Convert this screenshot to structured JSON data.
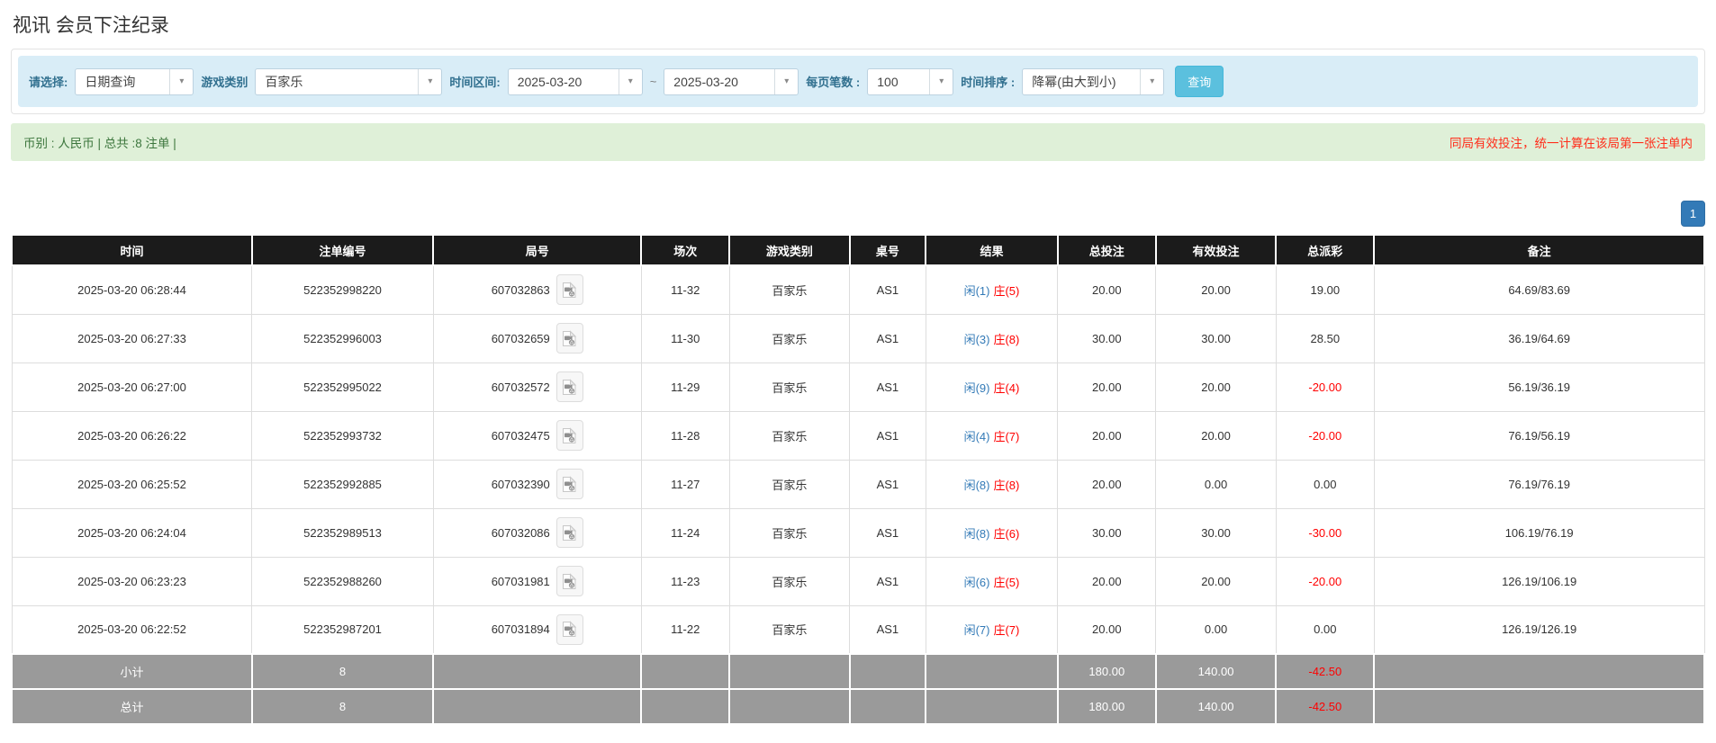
{
  "page": {
    "title": "视讯 会员下注纪录"
  },
  "filters": {
    "select_label": "请选择:",
    "select_value": "日期查询",
    "game_type_label": "游戏类别",
    "game_type_value": "百家乐",
    "date_range_label": "时间区间:",
    "date_from": "2025-03-20",
    "date_separator": "~",
    "date_to": "2025-03-20",
    "page_size_label": "每页笔数 :",
    "page_size_value": "100",
    "sort_label": "时间排序 :",
    "sort_value": "降幂(由大到小)",
    "query_button": "查询"
  },
  "summary": {
    "left": "币别 : 人民币 | 总共 :8 注单 |",
    "right": "同局有效投注，统一计算在该局第一张注单内"
  },
  "pagination": {
    "current": "1"
  },
  "icons": {
    "video_icon": "video-replay-file",
    "chevron": "▾"
  },
  "colors": {
    "accent_blue": "#5bc0de",
    "link_blue": "#337ab7",
    "negative_red": "#ff0000",
    "header_bg": "#1b1b1b",
    "footer_bg": "#9a9a9a",
    "filter_bg": "#d9edf7",
    "summary_bg": "#dff0d8",
    "summary_green": "#3c763d"
  },
  "table": {
    "headers": [
      "时间",
      "注单编号",
      "局号",
      "场次",
      "游戏类别",
      "桌号",
      "结果",
      "总投注",
      "有效投注",
      "总派彩",
      "备注"
    ],
    "rows": [
      {
        "time": "2025-03-20 06:28:44",
        "bet_id": "522352998220",
        "round_id": "607032863",
        "session": "11-32",
        "game": "百家乐",
        "table_no": "AS1",
        "result_player": "闲(1)",
        "result_banker": "庄(5)",
        "total_bet": "20.00",
        "valid_bet": "20.00",
        "payout": "19.00",
        "remark": "64.69/83.69"
      },
      {
        "time": "2025-03-20 06:27:33",
        "bet_id": "522352996003",
        "round_id": "607032659",
        "session": "11-30",
        "game": "百家乐",
        "table_no": "AS1",
        "result_player": "闲(3)",
        "result_banker": "庄(8)",
        "total_bet": "30.00",
        "valid_bet": "30.00",
        "payout": "28.50",
        "remark": "36.19/64.69"
      },
      {
        "time": "2025-03-20 06:27:00",
        "bet_id": "522352995022",
        "round_id": "607032572",
        "session": "11-29",
        "game": "百家乐",
        "table_no": "AS1",
        "result_player": "闲(9)",
        "result_banker": "庄(4)",
        "total_bet": "20.00",
        "valid_bet": "20.00",
        "payout": "-20.00",
        "remark": "56.19/36.19"
      },
      {
        "time": "2025-03-20 06:26:22",
        "bet_id": "522352993732",
        "round_id": "607032475",
        "session": "11-28",
        "game": "百家乐",
        "table_no": "AS1",
        "result_player": "闲(4)",
        "result_banker": "庄(7)",
        "total_bet": "20.00",
        "valid_bet": "20.00",
        "payout": "-20.00",
        "remark": "76.19/56.19"
      },
      {
        "time": "2025-03-20 06:25:52",
        "bet_id": "522352992885",
        "round_id": "607032390",
        "session": "11-27",
        "game": "百家乐",
        "table_no": "AS1",
        "result_player": "闲(8)",
        "result_banker": "庄(8)",
        "total_bet": "20.00",
        "valid_bet": "0.00",
        "payout": "0.00",
        "remark": "76.19/76.19"
      },
      {
        "time": "2025-03-20 06:24:04",
        "bet_id": "522352989513",
        "round_id": "607032086",
        "session": "11-24",
        "game": "百家乐",
        "table_no": "AS1",
        "result_player": "闲(8)",
        "result_banker": "庄(6)",
        "total_bet": "30.00",
        "valid_bet": "30.00",
        "payout": "-30.00",
        "remark": "106.19/76.19"
      },
      {
        "time": "2025-03-20 06:23:23",
        "bet_id": "522352988260",
        "round_id": "607031981",
        "session": "11-23",
        "game": "百家乐",
        "table_no": "AS1",
        "result_player": "闲(6)",
        "result_banker": "庄(5)",
        "total_bet": "20.00",
        "valid_bet": "20.00",
        "payout": "-20.00",
        "remark": "126.19/106.19"
      },
      {
        "time": "2025-03-20 06:22:52",
        "bet_id": "522352987201",
        "round_id": "607031894",
        "session": "11-22",
        "game": "百家乐",
        "table_no": "AS1",
        "result_player": "闲(7)",
        "result_banker": "庄(7)",
        "total_bet": "20.00",
        "valid_bet": "0.00",
        "payout": "0.00",
        "remark": "126.19/126.19"
      }
    ],
    "subtotal": {
      "label": "小计",
      "count": "8",
      "total_bet": "180.00",
      "valid_bet": "140.00",
      "payout": "-42.50"
    },
    "total": {
      "label": "总计",
      "count": "8",
      "total_bet": "180.00",
      "valid_bet": "140.00",
      "payout": "-42.50"
    }
  }
}
